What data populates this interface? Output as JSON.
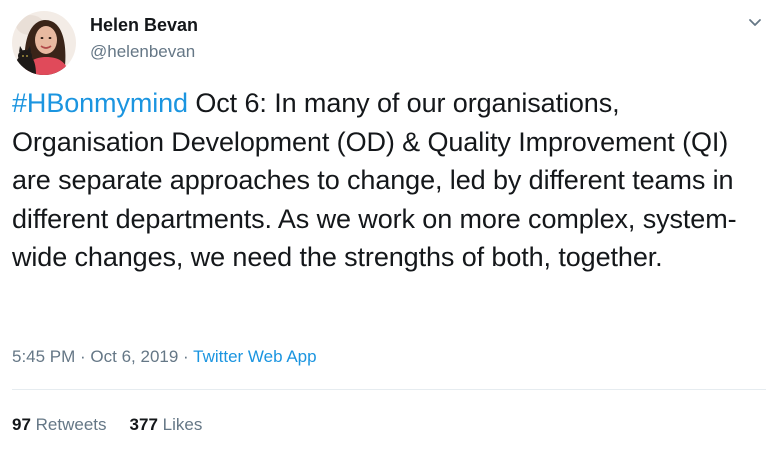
{
  "author": {
    "display_name": "Helen Bevan",
    "handle": "@helenbevan",
    "avatar_icon": "profile-photo"
  },
  "menu": {
    "icon": "chevron-down-icon"
  },
  "tweet": {
    "hashtag": "#HBonmymind",
    "body": " Oct 6: In many of our organisations, Organisation Development (OD) & Quality Improvement (QI) are separate approaches to change, led by different teams in different departments. As we work on more complex, system-wide changes, we need the strengths of both, together."
  },
  "meta": {
    "time": "5:45 PM",
    "separator": " · ",
    "date": "Oct 6, 2019",
    "source": "Twitter Web App"
  },
  "stats": {
    "retweets_count": "97",
    "retweets_label": "Retweets",
    "likes_count": "377",
    "likes_label": "Likes"
  },
  "colors": {
    "link": "#1b95e0",
    "text": "#14171a",
    "secondary": "#657786",
    "divider": "#e6ecf0"
  }
}
